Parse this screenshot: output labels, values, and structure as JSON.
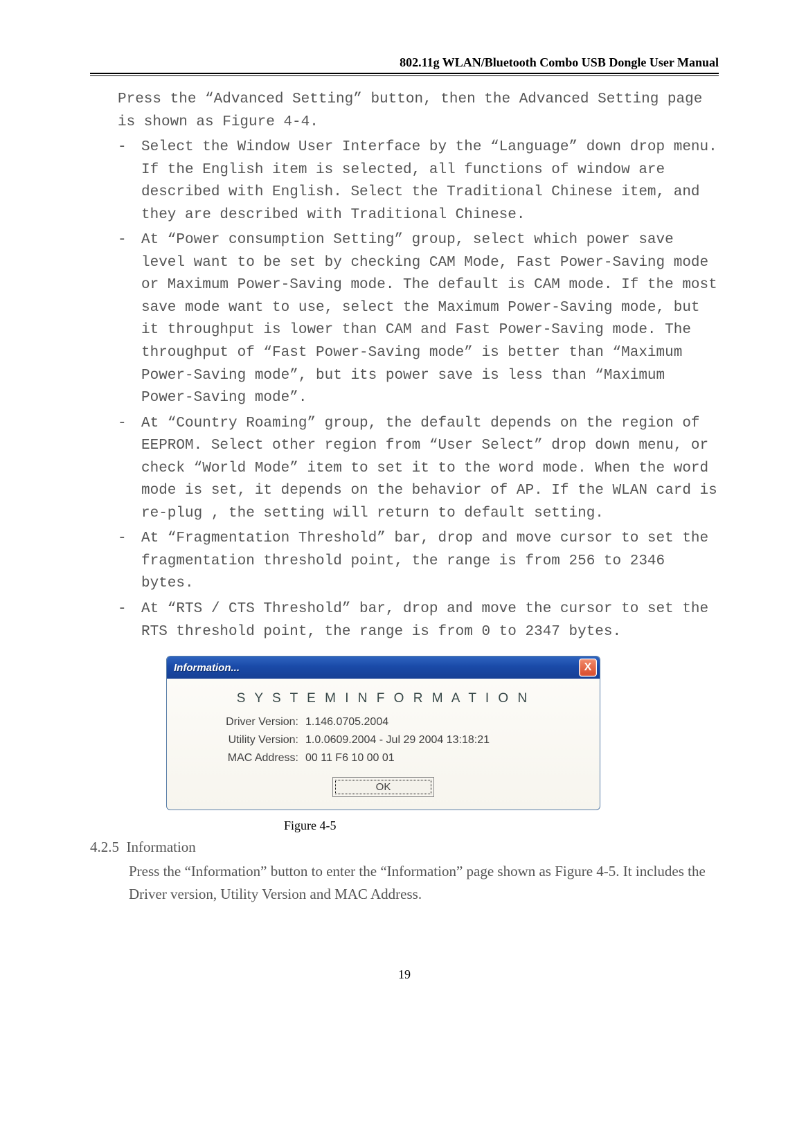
{
  "header": {
    "title": "802.11g WLAN/Bluetooth Combo USB Dongle User Manual"
  },
  "intro": "Press the “Advanced Setting” button, then the Advanced Setting page is shown as Figure 4-4.",
  "bullets": [
    " Select the Window User Interface by the “Language” down drop menu. If the English item is selected, all functions of window are described with English. Select the Traditional Chinese item, and they are described with Traditional Chinese.",
    "At “Power consumption Setting” group, select which power save level want to be set by checking CAM Mode, Fast Power-Saving mode or Maximum Power-Saving mode. The default is CAM mode. If the most save mode want to use, select the Maximum Power-Saving mode, but it throughput is lower than CAM and Fast Power-Saving mode. The throughput of  “Fast Power-Saving mode” is better than “Maximum Power-Saving mode”, but its power save is less than “Maximum Power-Saving mode”.",
    "At “Country Roaming” group, the default depends on the region of EEPROM. Select other region from “User Select” drop down menu, or check “World Mode” item to set it to the word mode. When the word mode is set, it depends on the behavior of AP. If the WLAN card is re-plug , the setting will return to default setting.",
    "At “Fragmentation Threshold” bar, drop and move cursor to set the fragmentation threshold point, the range is from 256 to 2346 bytes.",
    "At “RTS / CTS Threshold” bar, drop and move the cursor to set the RTS threshold point, the range is from 0 to 2347 bytes."
  ],
  "dialog": {
    "title": "Information...",
    "heading": "S Y S T E M   I N F O R M A T I O N",
    "rows": [
      {
        "label": "Driver Version:",
        "value": "1.146.0705.2004"
      },
      {
        "label": "Utility Version:",
        "value": "1.0.0609.2004 - Jul 29 2004 13:18:21"
      },
      {
        "label": "MAC Address:",
        "value": "00 11 F6 10 00 01"
      }
    ],
    "ok": "OK",
    "close": "X"
  },
  "figure_caption": "Figure 4-5",
  "section": {
    "number": "4.2.5",
    "title": "Information",
    "body": "Press the “Information” button to enter the “Information” page shown as Figure 4-5. It includes the Driver version, Utility Version and MAC Address."
  },
  "page_number": "19"
}
